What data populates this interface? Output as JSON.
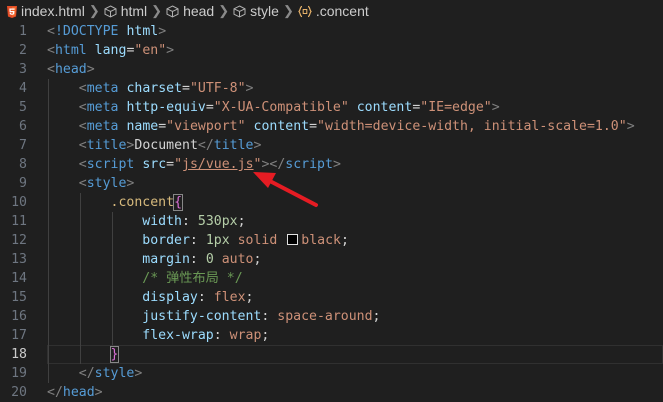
{
  "breadcrumb": {
    "file": "index.html",
    "items": [
      "html",
      "head",
      "style",
      ".concent"
    ]
  },
  "colors": {
    "background": "#1f1f1f",
    "arrow": "#e51c23",
    "swatch_black": "#000000"
  },
  "lines": [
    {
      "n": "1",
      "tokens": [
        {
          "c": "t-punc",
          "t": "<"
        },
        {
          "c": "t-tag",
          "t": "!DOCTYPE"
        },
        {
          "c": "t-text",
          "t": " "
        },
        {
          "c": "t-attr",
          "t": "html"
        },
        {
          "c": "t-punc",
          "t": ">"
        }
      ]
    },
    {
      "n": "2",
      "tokens": [
        {
          "c": "t-punc",
          "t": "<"
        },
        {
          "c": "t-tag",
          "t": "html"
        },
        {
          "c": "t-text",
          "t": " "
        },
        {
          "c": "t-attr",
          "t": "lang"
        },
        {
          "c": "t-text",
          "t": "="
        },
        {
          "c": "t-str",
          "t": "\"en\""
        },
        {
          "c": "t-punc",
          "t": ">"
        }
      ]
    },
    {
      "n": "3",
      "tokens": [
        {
          "c": "t-punc",
          "t": "<"
        },
        {
          "c": "t-tag",
          "t": "head"
        },
        {
          "c": "t-punc",
          "t": ">"
        }
      ]
    },
    {
      "n": "4",
      "tokens": [
        {
          "c": "t-text",
          "t": "    "
        },
        {
          "c": "t-punc",
          "t": "<"
        },
        {
          "c": "t-tag",
          "t": "meta"
        },
        {
          "c": "t-text",
          "t": " "
        },
        {
          "c": "t-attr",
          "t": "charset"
        },
        {
          "c": "t-text",
          "t": "="
        },
        {
          "c": "t-str",
          "t": "\"UTF-8\""
        },
        {
          "c": "t-punc",
          "t": ">"
        }
      ]
    },
    {
      "n": "5",
      "tokens": [
        {
          "c": "t-text",
          "t": "    "
        },
        {
          "c": "t-punc",
          "t": "<"
        },
        {
          "c": "t-tag",
          "t": "meta"
        },
        {
          "c": "t-text",
          "t": " "
        },
        {
          "c": "t-attr",
          "t": "http-equiv"
        },
        {
          "c": "t-text",
          "t": "="
        },
        {
          "c": "t-str",
          "t": "\"X-UA-Compatible\""
        },
        {
          "c": "t-text",
          "t": " "
        },
        {
          "c": "t-attr",
          "t": "content"
        },
        {
          "c": "t-text",
          "t": "="
        },
        {
          "c": "t-str",
          "t": "\"IE=edge\""
        },
        {
          "c": "t-punc",
          "t": ">"
        }
      ]
    },
    {
      "n": "6",
      "tokens": [
        {
          "c": "t-text",
          "t": "    "
        },
        {
          "c": "t-punc",
          "t": "<"
        },
        {
          "c": "t-tag",
          "t": "meta"
        },
        {
          "c": "t-text",
          "t": " "
        },
        {
          "c": "t-attr",
          "t": "name"
        },
        {
          "c": "t-text",
          "t": "="
        },
        {
          "c": "t-str",
          "t": "\"viewport\""
        },
        {
          "c": "t-text",
          "t": " "
        },
        {
          "c": "t-attr",
          "t": "content"
        },
        {
          "c": "t-text",
          "t": "="
        },
        {
          "c": "t-str",
          "t": "\"width=device-width, initial-scale=1.0\""
        },
        {
          "c": "t-punc",
          "t": ">"
        }
      ]
    },
    {
      "n": "7",
      "tokens": [
        {
          "c": "t-text",
          "t": "    "
        },
        {
          "c": "t-punc",
          "t": "<"
        },
        {
          "c": "t-tag",
          "t": "title"
        },
        {
          "c": "t-punc",
          "t": ">"
        },
        {
          "c": "t-text",
          "t": "Document"
        },
        {
          "c": "t-punc",
          "t": "</"
        },
        {
          "c": "t-tag",
          "t": "title"
        },
        {
          "c": "t-punc",
          "t": ">"
        }
      ]
    },
    {
      "n": "8",
      "tokens": [
        {
          "c": "t-text",
          "t": "    "
        },
        {
          "c": "t-punc",
          "t": "<"
        },
        {
          "c": "t-tag",
          "t": "script"
        },
        {
          "c": "t-text",
          "t": " "
        },
        {
          "c": "t-attr",
          "t": "src"
        },
        {
          "c": "t-text",
          "t": "="
        },
        {
          "c": "t-str",
          "t": "\""
        },
        {
          "c": "t-link",
          "t": "js/vue.js"
        },
        {
          "c": "t-str",
          "t": "\""
        },
        {
          "c": "t-punc",
          "t": "></"
        },
        {
          "c": "t-tag",
          "t": "script"
        },
        {
          "c": "t-punc",
          "t": ">"
        }
      ]
    },
    {
      "n": "9",
      "tokens": [
        {
          "c": "t-text",
          "t": "    "
        },
        {
          "c": "t-punc",
          "t": "<"
        },
        {
          "c": "t-tag",
          "t": "style"
        },
        {
          "c": "t-punc",
          "t": ">"
        }
      ]
    },
    {
      "n": "10",
      "tokens": [
        {
          "c": "t-text",
          "t": "        "
        },
        {
          "c": "t-sel",
          "t": ".concent"
        },
        {
          "c": "t-brace-match",
          "t": "{"
        }
      ]
    },
    {
      "n": "11",
      "tokens": [
        {
          "c": "t-text",
          "t": "            "
        },
        {
          "c": "t-prop",
          "t": "width"
        },
        {
          "c": "t-text",
          "t": ": "
        },
        {
          "c": "t-num",
          "t": "530px"
        },
        {
          "c": "t-text",
          "t": ";"
        }
      ]
    },
    {
      "n": "12",
      "tokens": [
        {
          "c": "t-text",
          "t": "            "
        },
        {
          "c": "t-prop",
          "t": "border"
        },
        {
          "c": "t-text",
          "t": ": "
        },
        {
          "c": "t-num",
          "t": "1px"
        },
        {
          "c": "t-text",
          "t": " "
        },
        {
          "c": "t-val",
          "t": "solid"
        },
        {
          "c": "t-text",
          "t": " "
        },
        {
          "c": "swatch",
          "t": ""
        },
        {
          "c": "t-val",
          "t": "black"
        },
        {
          "c": "t-text",
          "t": ";"
        }
      ]
    },
    {
      "n": "13",
      "tokens": [
        {
          "c": "t-text",
          "t": "            "
        },
        {
          "c": "t-prop",
          "t": "margin"
        },
        {
          "c": "t-text",
          "t": ": "
        },
        {
          "c": "t-num",
          "t": "0"
        },
        {
          "c": "t-text",
          "t": " "
        },
        {
          "c": "t-val",
          "t": "auto"
        },
        {
          "c": "t-text",
          "t": ";"
        }
      ]
    },
    {
      "n": "14",
      "tokens": [
        {
          "c": "t-text",
          "t": "            "
        },
        {
          "c": "t-com",
          "t": "/* 弹性布局 */"
        }
      ]
    },
    {
      "n": "15",
      "tokens": [
        {
          "c": "t-text",
          "t": "            "
        },
        {
          "c": "t-prop",
          "t": "display"
        },
        {
          "c": "t-text",
          "t": ": "
        },
        {
          "c": "t-val",
          "t": "flex"
        },
        {
          "c": "t-text",
          "t": ";"
        }
      ]
    },
    {
      "n": "16",
      "tokens": [
        {
          "c": "t-text",
          "t": "            "
        },
        {
          "c": "t-prop",
          "t": "justify-content"
        },
        {
          "c": "t-text",
          "t": ": "
        },
        {
          "c": "t-val",
          "t": "space-around"
        },
        {
          "c": "t-text",
          "t": ";"
        }
      ]
    },
    {
      "n": "17",
      "tokens": [
        {
          "c": "t-text",
          "t": "            "
        },
        {
          "c": "t-prop",
          "t": "flex-wrap"
        },
        {
          "c": "t-text",
          "t": ": "
        },
        {
          "c": "t-val",
          "t": "wrap"
        },
        {
          "c": "t-text",
          "t": ";"
        }
      ]
    },
    {
      "n": "18",
      "current": true,
      "tokens": [
        {
          "c": "t-text",
          "t": "        "
        },
        {
          "c": "t-brace-match",
          "t": "}"
        }
      ]
    },
    {
      "n": "19",
      "tokens": [
        {
          "c": "t-text",
          "t": "    "
        },
        {
          "c": "t-punc",
          "t": "</"
        },
        {
          "c": "t-tag",
          "t": "style"
        },
        {
          "c": "t-punc",
          "t": ">"
        }
      ]
    },
    {
      "n": "20",
      "tokens": [
        {
          "c": "t-punc",
          "t": "</"
        },
        {
          "c": "t-tag",
          "t": "head"
        },
        {
          "c": "t-punc",
          "t": ">"
        }
      ]
    }
  ]
}
